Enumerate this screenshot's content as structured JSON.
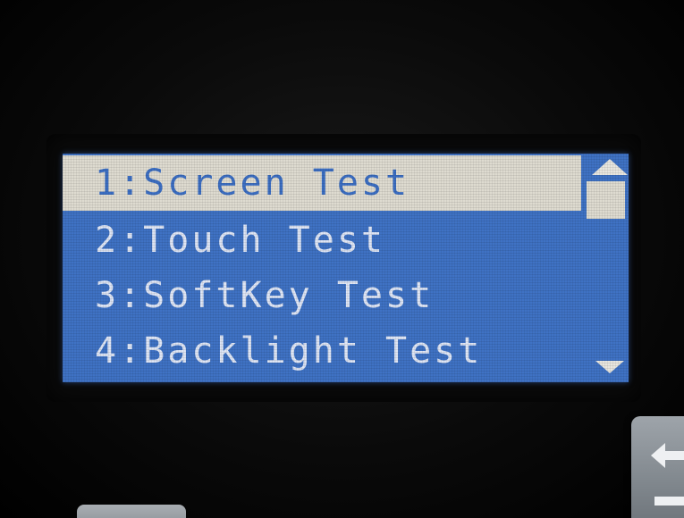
{
  "menu": {
    "items": [
      {
        "label": "1:Screen Test",
        "selected": true
      },
      {
        "label": "2:Touch Test",
        "selected": false
      },
      {
        "label": "3:SoftKey Test",
        "selected": false
      },
      {
        "label": "4:Backlight Test",
        "selected": false
      }
    ]
  },
  "colors": {
    "screen_background": "#3f72c4",
    "highlight": "#dedbd0",
    "text": "#dfe6f5"
  },
  "icons": {
    "scroll_up": "triangle-up-icon",
    "scroll_down": "triangle-down-icon",
    "back": "back-arrow-icon"
  }
}
